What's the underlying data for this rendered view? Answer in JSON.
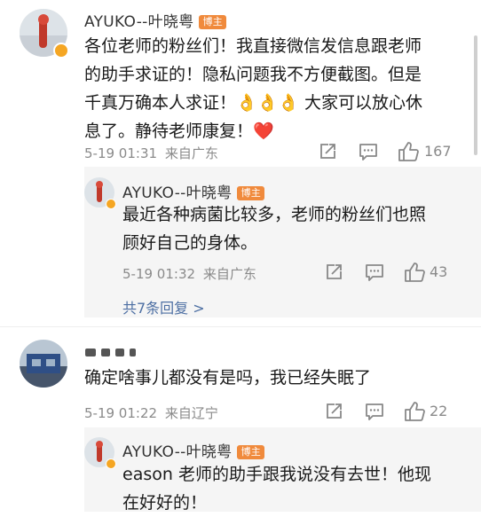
{
  "comments": [
    {
      "user": "AYUKO--叶晓粤",
      "badge": "博主",
      "text": "各位老师的粉丝们！我直接微信发信息跟老师\n的助手求证的！隐私问题我不方便截图。但是\n千真万确本人求证！👌👌👌 大家可以放心休\n息了。静待老师康复！❤️",
      "time": "5-19 01:31",
      "location": "来自广东",
      "likes": "167",
      "replies": [
        {
          "user": "AYUKO--叶晓粤",
          "badge": "博主",
          "text": "最近各种病菌比较多，老师的粉丝们也照\n顾好自己的身体。",
          "time": "5-19 01:32",
          "location": "来自广东",
          "likes": "43"
        }
      ],
      "more_replies": "共7条回复 >"
    },
    {
      "user": "",
      "text": "确定啥事儿都没有是吗，我已经失眠了",
      "time": "5-19 01:22",
      "location": "来自辽宁",
      "likes": "22",
      "replies": [
        {
          "user": "AYUKO--叶晓粤",
          "badge": "博主",
          "text": "eason 老师的助手跟我说没有去世！他现\n在好好的！"
        }
      ]
    }
  ],
  "icons": {
    "share": "share-icon",
    "comment": "comment-icon",
    "like": "thumb-up-icon"
  },
  "colors": {
    "badge": "#f08a3c",
    "link": "#4d6fa3",
    "meta": "#8a8a8a"
  }
}
